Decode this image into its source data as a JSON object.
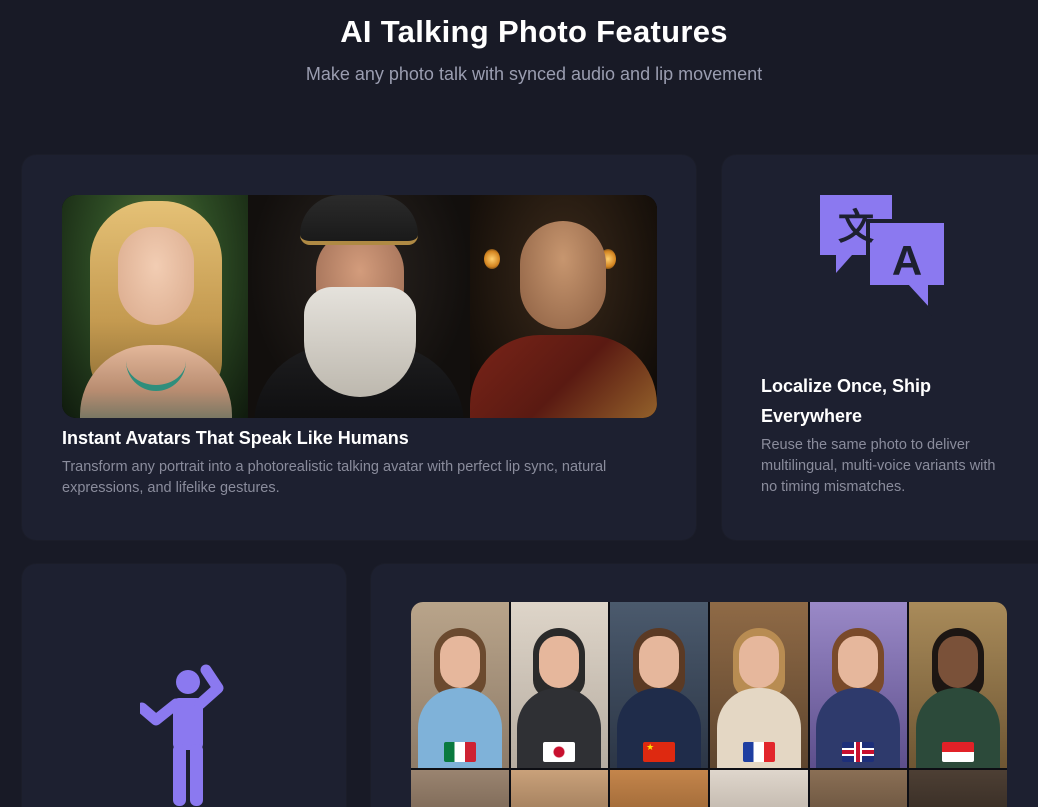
{
  "header": {
    "title": "AI Talking Photo Features",
    "subtitle": "Make any photo talk with synced audio and lip movement"
  },
  "cards": {
    "avatars": {
      "title": "Instant Avatars That Speak Like Humans",
      "description": "Transform any portrait into a photorealistic talking avatar with perfect lip sync, natural expressions, and lifelike gestures."
    },
    "localize": {
      "title": "Localize Once, Ship Everywhere",
      "description": "Reuse the same photo to deliver multilingual, multi-voice variants with no timing mismatches.",
      "icon": "translate-icon",
      "icon_glyph_left": "文",
      "icon_glyph_right": "A"
    },
    "gesture": {
      "icon": "waving-person-icon"
    },
    "grid": {
      "flags": [
        "mexico",
        "japan",
        "china",
        "france",
        "united-kingdom",
        "indonesia"
      ]
    }
  },
  "colors": {
    "background": "#181a26",
    "card": "#1d2030",
    "accent": "#8b79f0",
    "muted_text": "#8a8c9c"
  }
}
